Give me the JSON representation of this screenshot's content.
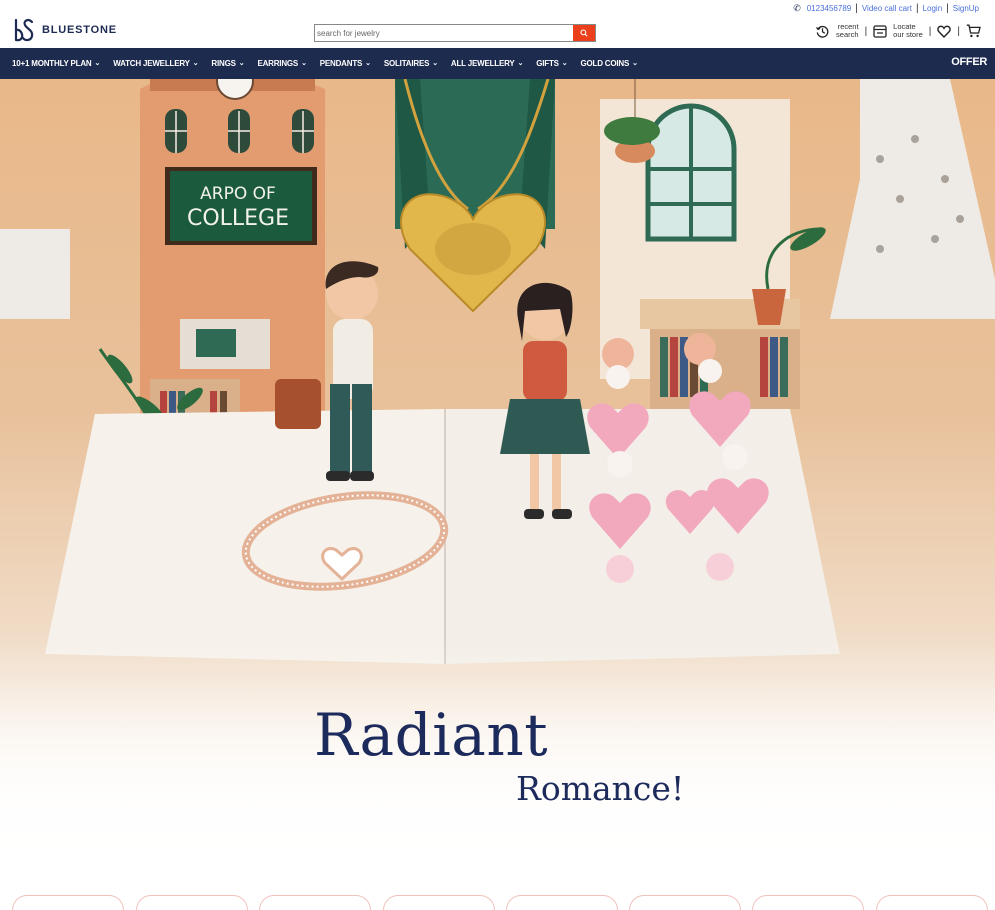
{
  "brand": {
    "name": "BLUESTONE"
  },
  "toplinks": {
    "phone": "0123456789",
    "video_call": "Video call cart",
    "login": "Login",
    "signup": "SignUp"
  },
  "search": {
    "placeholder": "search for jewelry"
  },
  "utils": {
    "recent_line1": "recent",
    "recent_line2": "search",
    "store_line1": "Locate",
    "store_line2": "our store"
  },
  "nav": {
    "items": [
      {
        "label": "10+1 MONTHLY PLAN"
      },
      {
        "label": "WATCH JEWELLERY"
      },
      {
        "label": "RINGS"
      },
      {
        "label": "EARRINGS"
      },
      {
        "label": "PENDANTS"
      },
      {
        "label": "SOLITAIRES"
      },
      {
        "label": "ALL JEWELLERY"
      },
      {
        "label": "GIFTS"
      },
      {
        "label": "GOLD COINS"
      }
    ],
    "offer": "OFFER"
  },
  "hero": {
    "title": "Radiant",
    "subtitle": "Romance!",
    "board_line1": "ARPO OF",
    "board_line2": "COLLEGE"
  },
  "colors": {
    "nav_bg": "#1d2b4f",
    "accent": "#ec3f1c",
    "headline": "#1d2b5c",
    "link": "#4a6fd8"
  }
}
